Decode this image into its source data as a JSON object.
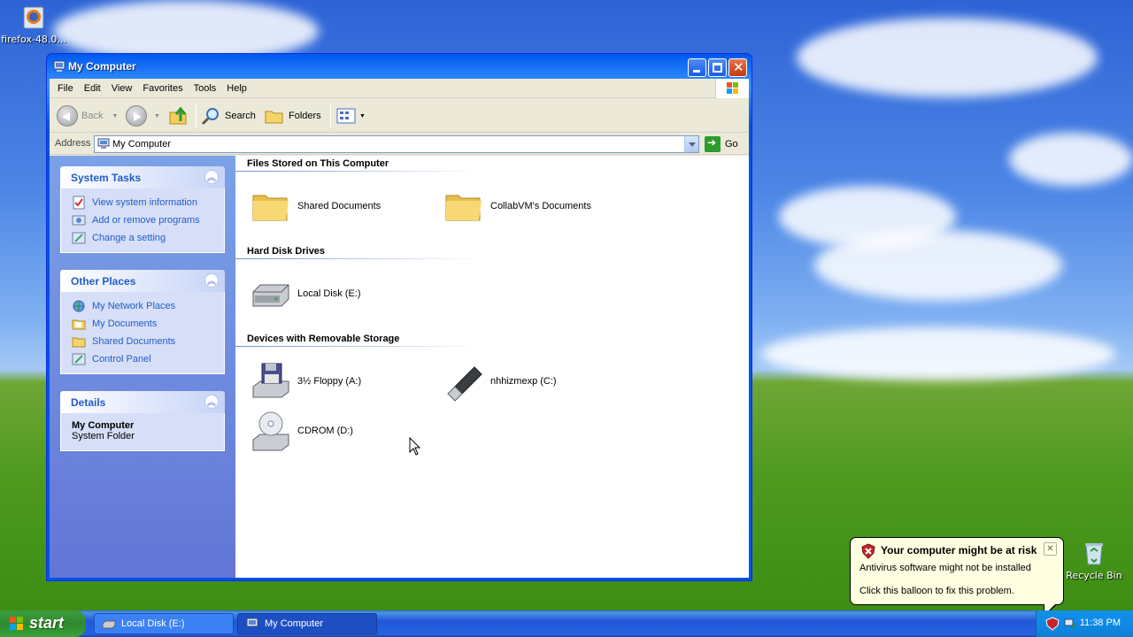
{
  "desktop": {
    "icons": [
      {
        "label": "firefox-48.0...",
        "icon": "firefox-installer-icon"
      },
      {
        "label": "Recycle Bin",
        "icon": "recycle-bin-icon"
      }
    ]
  },
  "window": {
    "title": "My Computer",
    "menu": [
      "File",
      "Edit",
      "View",
      "Favorites",
      "Tools",
      "Help"
    ],
    "toolbar": {
      "back": "Back",
      "search": "Search",
      "folders": "Folders"
    },
    "address": {
      "label": "Address",
      "value": "My Computer",
      "go": "Go"
    },
    "task_pane": {
      "system_tasks": {
        "title": "System Tasks",
        "items": [
          "View system information",
          "Add or remove programs",
          "Change a setting"
        ]
      },
      "other_places": {
        "title": "Other Places",
        "items": [
          "My Network Places",
          "My Documents",
          "Shared Documents",
          "Control Panel"
        ]
      },
      "details": {
        "title": "Details",
        "name": "My Computer",
        "type": "System Folder"
      }
    },
    "groups": {
      "files": {
        "title": "Files Stored on This Computer",
        "items": [
          "Shared Documents",
          "CollabVM's Documents"
        ]
      },
      "disks": {
        "title": "Hard Disk Drives",
        "items": [
          "Local Disk (E:)"
        ]
      },
      "removable": {
        "title": "Devices with Removable Storage",
        "items": [
          "3½ Floppy (A:)",
          "nhhizmexp (C:)",
          "CDROM (D:)"
        ]
      }
    }
  },
  "taskbar": {
    "start": "start",
    "tasks": [
      "Local Disk (E:)",
      "My Computer"
    ],
    "clock": "11:38 PM"
  },
  "balloon": {
    "title": "Your computer might be at risk",
    "line1": "Antivirus software might not be installed",
    "line2": "Click this balloon to fix this problem."
  },
  "colors": {
    "titlebar": "#0054e3",
    "taskpane_link": "#215dc6",
    "start_green": "#3c9d3c",
    "balloon_bg": "#ffffe1"
  }
}
